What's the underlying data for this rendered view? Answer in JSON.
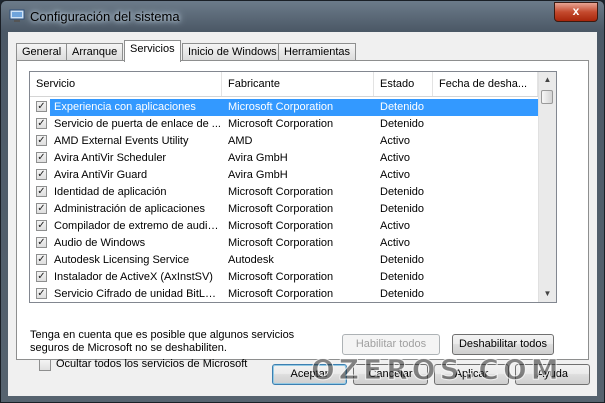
{
  "window": {
    "title": "Configuración del sistema",
    "close_glyph": "x"
  },
  "tabs": [
    {
      "label": "General"
    },
    {
      "label": "Arranque"
    },
    {
      "label": "Servicios"
    },
    {
      "label": "Inicio de Windows"
    },
    {
      "label": "Herramientas"
    }
  ],
  "active_tab": "Servicios",
  "table": {
    "columns": [
      "Servicio",
      "Fabricante",
      "Estado",
      "Fecha de desha..."
    ],
    "rows": [
      {
        "servicio": "Experiencia con aplicaciones",
        "fabricante": "Microsoft Corporation",
        "estado": "Detenido",
        "fecha": "",
        "checked": true,
        "selected": true
      },
      {
        "servicio": "Servicio de puerta de enlace de ...",
        "fabricante": "Microsoft Corporation",
        "estado": "Detenido",
        "fecha": "",
        "checked": true
      },
      {
        "servicio": "AMD External Events Utility",
        "fabricante": "AMD",
        "estado": "Activo",
        "fecha": "",
        "checked": true
      },
      {
        "servicio": "Avira AntiVir Scheduler",
        "fabricante": "Avira GmbH",
        "estado": "Activo",
        "fecha": "",
        "checked": true
      },
      {
        "servicio": "Avira AntiVir Guard",
        "fabricante": "Avira GmbH",
        "estado": "Activo",
        "fecha": "",
        "checked": true
      },
      {
        "servicio": "Identidad de aplicación",
        "fabricante": "Microsoft Corporation",
        "estado": "Detenido",
        "fecha": "",
        "checked": true
      },
      {
        "servicio": "Administración de aplicaciones",
        "fabricante": "Microsoft Corporation",
        "estado": "Detenido",
        "fecha": "",
        "checked": true
      },
      {
        "servicio": "Compilador de extremo de audio...",
        "fabricante": "Microsoft Corporation",
        "estado": "Activo",
        "fecha": "",
        "checked": true
      },
      {
        "servicio": "Audio de Windows",
        "fabricante": "Microsoft Corporation",
        "estado": "Activo",
        "fecha": "",
        "checked": true
      },
      {
        "servicio": "Autodesk Licensing Service",
        "fabricante": "Autodesk",
        "estado": "Detenido",
        "fecha": "",
        "checked": true
      },
      {
        "servicio": "Instalador de ActiveX (AxInstSV)",
        "fabricante": "Microsoft Corporation",
        "estado": "Detenido",
        "fecha": "",
        "checked": true
      },
      {
        "servicio": "Servicio Cifrado de unidad BitLoc...",
        "fabricante": "Microsoft Corporation",
        "estado": "Detenido",
        "fecha": "",
        "checked": true
      }
    ]
  },
  "note": {
    "line1": "Tenga en cuenta que es posible que algunos servicios",
    "line2": "seguros de Microsoft no se deshabiliten."
  },
  "buttons": {
    "enable_all": "Habilitar todos",
    "disable_all": "Deshabilitar todos",
    "ok": "Aceptar",
    "cancel": "Cancelar",
    "apply": "Aplicar",
    "help": "Ayuda"
  },
  "hide_ms_checkbox": {
    "label": "Ocultar todos los servicios de Microsoft",
    "checked": false
  },
  "watermark": "OZEROS.COM",
  "colors": {
    "selection": "#3399ff",
    "title_glow": "#cfe0ef",
    "close": "#c44a2e"
  }
}
